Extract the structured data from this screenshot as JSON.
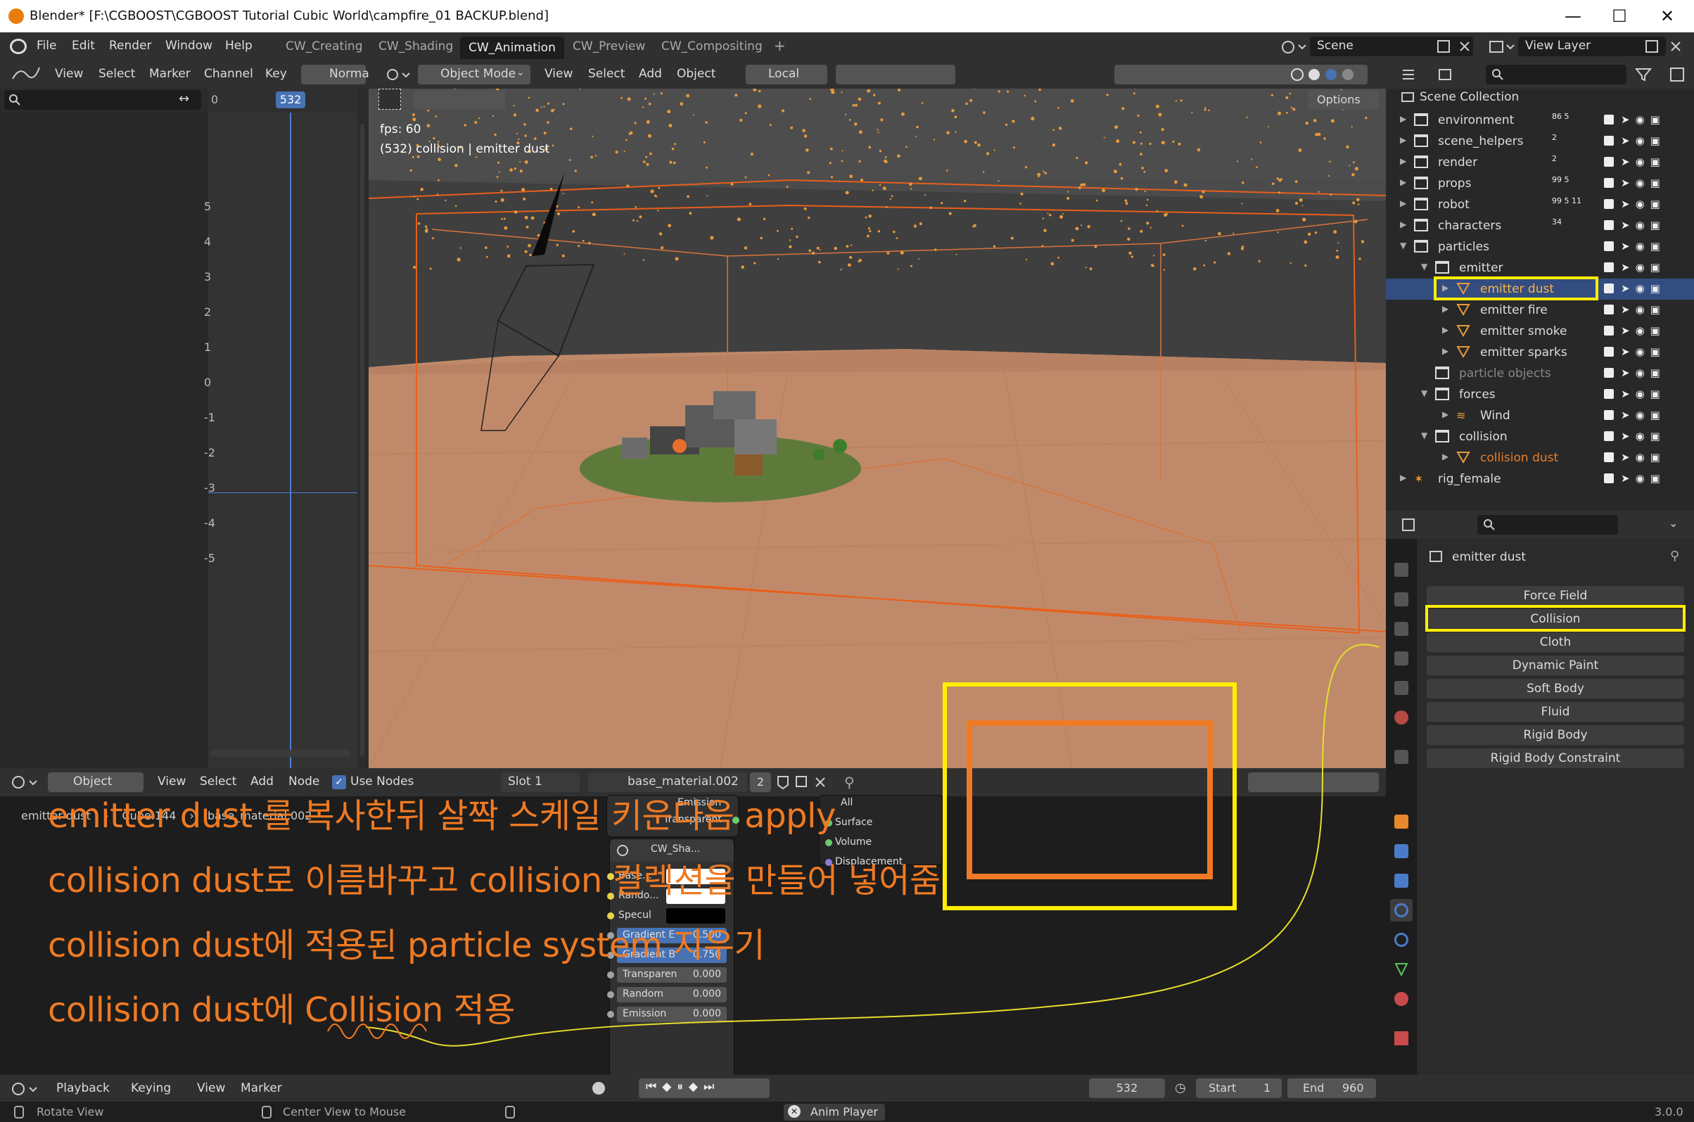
{
  "window": {
    "title": "Blender* [F:\\CGBOOST\\CGBOOST Tutorial Cubic World\\campfire_01 BACKUP.blend]",
    "minimize": "—",
    "maximize": "☐",
    "close": "✕"
  },
  "menubar": {
    "menus": [
      "File",
      "Edit",
      "Render",
      "Window",
      "Help"
    ],
    "workspaces": [
      "CW_Creating",
      "CW_Shading",
      "CW_Animation",
      "CW_Preview",
      "CW_Compositing"
    ],
    "active_workspace": "CW_Animation",
    "add_tab": "+",
    "scene": "Scene",
    "view_layer": "View Layer"
  },
  "graph_editor": {
    "menus": [
      "View",
      "Select",
      "Marker",
      "Channel",
      "Key"
    ],
    "normalize": "Norma",
    "frame_start_label": "0",
    "current_frame": "532",
    "y_ticks": [
      "5",
      "4",
      "3",
      "2",
      "1",
      "0",
      "-1",
      "-2",
      "-3",
      "-4",
      "-5"
    ]
  },
  "viewport": {
    "mode": "Object Mode",
    "menus": [
      "View",
      "Select",
      "Add",
      "Object"
    ],
    "orientation": "Local",
    "options": "Options",
    "fps": "fps: 60",
    "info": "(532) collision | emitter dust"
  },
  "outliner": {
    "root": "Scene Collection",
    "rows": [
      {
        "label": "environment",
        "level": 0,
        "badges": "86 5"
      },
      {
        "label": "scene_helpers",
        "level": 0,
        "badges": "2"
      },
      {
        "label": "render",
        "level": 0,
        "badges": "2"
      },
      {
        "label": "props",
        "level": 0,
        "badges": "99 5"
      },
      {
        "label": "robot",
        "level": 0,
        "badges": "99 5 11"
      },
      {
        "label": "characters",
        "level": 0,
        "badges": "34"
      },
      {
        "label": "particles",
        "level": 0,
        "badges": ""
      },
      {
        "label": "emitter",
        "level": 1,
        "badges": ""
      },
      {
        "label": "emitter dust",
        "level": 2,
        "badges": ""
      },
      {
        "label": "emitter fire",
        "level": 2,
        "badges": ""
      },
      {
        "label": "emitter smoke",
        "level": 2,
        "badges": ""
      },
      {
        "label": "emitter sparks",
        "level": 2,
        "badges": ""
      },
      {
        "label": "particle objects",
        "level": 1,
        "badges": ""
      },
      {
        "label": "forces",
        "level": 1,
        "badges": ""
      },
      {
        "label": "Wind",
        "level": 2,
        "badges": ""
      },
      {
        "label": "collision",
        "level": 1,
        "badges": ""
      },
      {
        "label": "collision dust",
        "level": 2,
        "badges": ""
      },
      {
        "label": "rig_female",
        "level": 0,
        "badges": ""
      }
    ]
  },
  "properties": {
    "object_name": "emitter dust",
    "physics_buttons": [
      "Force Field",
      "Collision",
      "Cloth",
      "Dynamic Paint",
      "Soft Body",
      "Fluid",
      "Rigid Body",
      "Rigid Body Constraint"
    ]
  },
  "shader_editor": {
    "object_menu": "Object",
    "menus": [
      "View",
      "Select",
      "Add",
      "Node"
    ],
    "use_nodes": "Use Nodes",
    "slot": "Slot 1",
    "material": "base_material.002",
    "users": "2",
    "breadcrumb": [
      "emitter dust",
      "Cube.144",
      "base_material.002"
    ],
    "node_output": {
      "title": "Emission",
      "rows": [
        "Transparent"
      ]
    },
    "node_mat_output": {
      "title": "All",
      "rows": [
        "Surface",
        "Volume",
        "Displacement"
      ]
    },
    "group_node": {
      "title": "CW_Sha...",
      "rows": [
        {
          "label": "Base...",
          "value": ""
        },
        {
          "label": "Rando...",
          "value": ""
        },
        {
          "label": "Specul",
          "value": ""
        },
        {
          "label": "Gradient E",
          "value": "0.500"
        },
        {
          "label": "Gradient B",
          "value": "0.750"
        },
        {
          "label": "Transparen",
          "value": "0.000"
        },
        {
          "label": "Random",
          "value": "0.000"
        },
        {
          "label": "Emission",
          "value": "0.000"
        }
      ]
    }
  },
  "annotations": [
    "emitter dust 를 복사한뒤 살짝 스케일 키운다음 apply",
    "collision dust로 이름바꾸고 collision 컬렉션을 만들어 넣어줌",
    "collision dust에 적용된 particle system 지우기",
    "collision dust에 Collision 적용"
  ],
  "timeline": {
    "menus": [
      "Playback",
      "Keying",
      "View",
      "Marker"
    ],
    "current_frame": "532",
    "start_label": "Start",
    "start": "1",
    "end_label": "End",
    "end": "960"
  },
  "statusbar": {
    "left": "Rotate View",
    "middle": "Center View to Mouse",
    "center": "Anim Player",
    "version": "3.0.0"
  },
  "colors": {
    "accent": "#4772b3",
    "highlight": "#ffee00",
    "annotation": "#ef7a23",
    "object_orange": "#e79a3c"
  }
}
